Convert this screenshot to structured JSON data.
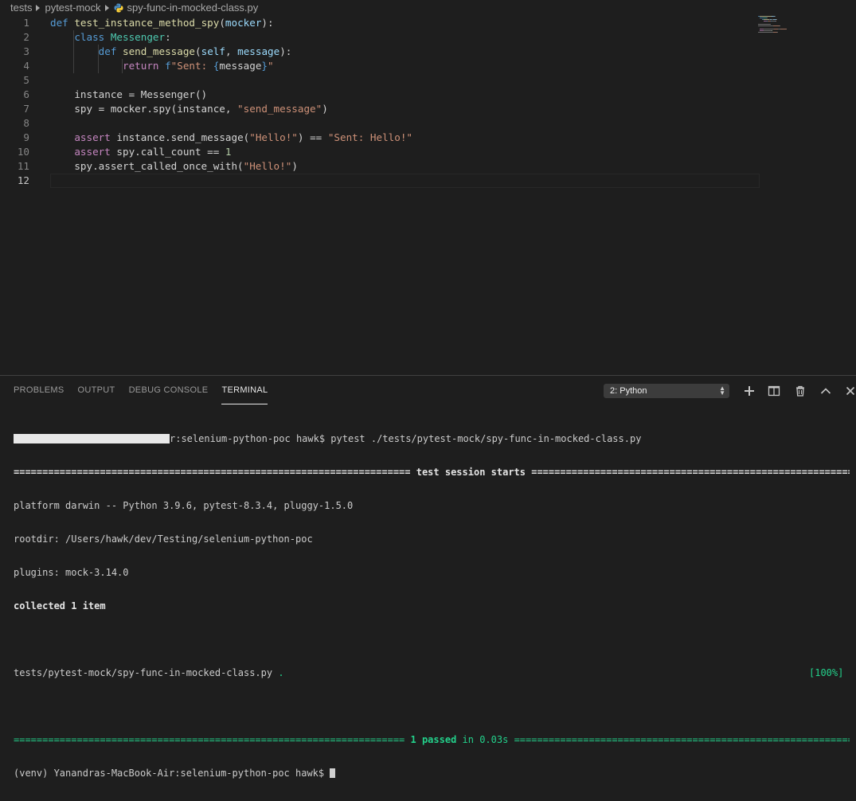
{
  "breadcrumb": {
    "items": [
      "tests",
      "pytest-mock",
      "spy-func-in-mocked-class.py"
    ]
  },
  "editor": {
    "line_numbers": [
      "1",
      "2",
      "3",
      "4",
      "5",
      "6",
      "7",
      "8",
      "9",
      "10",
      "11",
      "12"
    ],
    "current_line": 12,
    "lines": [
      [
        {
          "t": "kw",
          "v": "def "
        },
        {
          "t": "fn",
          "v": "test_instance_method_spy"
        },
        {
          "t": "txt",
          "v": "("
        },
        {
          "t": "prm",
          "v": "mocker"
        },
        {
          "t": "txt",
          "v": "):"
        }
      ],
      [
        {
          "t": "txt",
          "v": "    "
        },
        {
          "t": "kw",
          "v": "class "
        },
        {
          "t": "cls",
          "v": "Messenger"
        },
        {
          "t": "txt",
          "v": ":"
        }
      ],
      [
        {
          "t": "txt",
          "v": "        "
        },
        {
          "t": "kw",
          "v": "def "
        },
        {
          "t": "fn",
          "v": "send_message"
        },
        {
          "t": "txt",
          "v": "("
        },
        {
          "t": "prm",
          "v": "self"
        },
        {
          "t": "txt",
          "v": ", "
        },
        {
          "t": "prm",
          "v": "message"
        },
        {
          "t": "txt",
          "v": "):"
        }
      ],
      [
        {
          "t": "txt",
          "v": "            "
        },
        {
          "t": "kw2",
          "v": "return "
        },
        {
          "t": "kw",
          "v": "f"
        },
        {
          "t": "str",
          "v": "\"Sent: "
        },
        {
          "t": "kw",
          "v": "{"
        },
        {
          "t": "txt",
          "v": "message"
        },
        {
          "t": "kw",
          "v": "}"
        },
        {
          "t": "str",
          "v": "\""
        }
      ],
      [],
      [
        {
          "t": "txt",
          "v": "    instance = Messenger()"
        }
      ],
      [
        {
          "t": "txt",
          "v": "    spy = mocker.spy(instance, "
        },
        {
          "t": "str",
          "v": "\"send_message\""
        },
        {
          "t": "txt",
          "v": ")"
        }
      ],
      [],
      [
        {
          "t": "txt",
          "v": "    "
        },
        {
          "t": "kw2",
          "v": "assert "
        },
        {
          "t": "txt",
          "v": "instance.send_message("
        },
        {
          "t": "str",
          "v": "\"Hello!\""
        },
        {
          "t": "txt",
          "v": ") == "
        },
        {
          "t": "str",
          "v": "\"Sent: Hello!\""
        }
      ],
      [
        {
          "t": "txt",
          "v": "    "
        },
        {
          "t": "kw2",
          "v": "assert "
        },
        {
          "t": "txt",
          "v": "spy.call_count == "
        },
        {
          "t": "num",
          "v": "1"
        }
      ],
      [
        {
          "t": "txt",
          "v": "    spy.assert_called_once_with("
        },
        {
          "t": "str",
          "v": "\"Hello!\""
        },
        {
          "t": "txt",
          "v": ")"
        }
      ],
      []
    ]
  },
  "colors": {
    "kw": "#569cd6",
    "kw2": "#c586c0",
    "fn": "#dcdcaa",
    "cls": "#4ec9b0",
    "prm": "#9cdcfe",
    "str": "#ce9178",
    "num": "#b5cea8",
    "txt": "#d4d4d4",
    "terminal_green": "#23d18b"
  },
  "panel": {
    "tabs": [
      {
        "label": "PROBLEMS",
        "active": false
      },
      {
        "label": "OUTPUT",
        "active": false
      },
      {
        "label": "DEBUG CONSOLE",
        "active": false
      },
      {
        "label": "TERMINAL",
        "active": true
      }
    ],
    "terminal_select": "2: Python",
    "icons": [
      "plus-icon",
      "split-terminal-icon",
      "trash-icon",
      "chevron-up-icon",
      "close-icon"
    ]
  },
  "terminal": {
    "prompt_suffix": "r:selenium-python-poc hawk$ pytest ./tests/pytest-mock/spy-func-in-mocked-class.py",
    "session_sep_left": "=====================================================================",
    "session_title": " test session starts ",
    "session_sep_right": "=============================================================",
    "platform": "platform darwin -- Python 3.9.6, pytest-8.3.4, pluggy-1.5.0",
    "rootdir": "rootdir: /Users/hawk/dev/Testing/selenium-python-poc",
    "plugins": "plugins: mock-3.14.0",
    "collected": "collected 1 item",
    "result_file": "tests/pytest-mock/spy-func-in-mocked-class.py",
    "result_dot": " .",
    "result_percent": "[100%]",
    "passed_sep_left": "====================================================================",
    "passed_text": " 1 passed",
    "passed_time": " in 0.03s ",
    "passed_sep_right": "==================================================================",
    "last_prompt": "(venv) Yanandras-MacBook-Air:selenium-python-poc hawk$ "
  }
}
